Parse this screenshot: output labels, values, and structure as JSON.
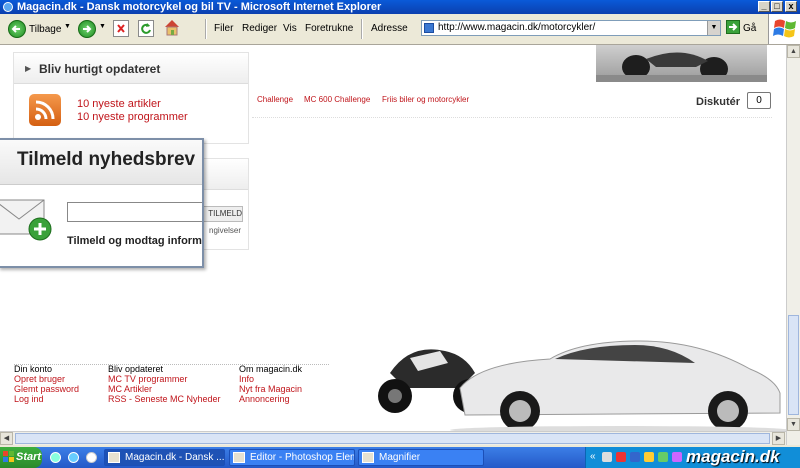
{
  "window": {
    "title": "Magacin.dk - Dansk motorcykel og bil TV - Microsoft Internet Explorer",
    "min": "_",
    "max": "□",
    "close": "x"
  },
  "toolbar": {
    "back_label": "Tilbage",
    "menu": [
      "Filer",
      "Rediger",
      "Vis",
      "Foretrukne"
    ],
    "address_label": "Adresse",
    "url": "http://www.magacin.dk/motorcykler/",
    "go_label": "Gå"
  },
  "page": {
    "bliv_title": "Bliv hurtigt opdateret",
    "bliv_links": [
      "10 nyeste artikler",
      "10 nyeste programmer"
    ],
    "tag_links": [
      "Challenge",
      "MC 600 Challenge",
      "Friis biler og motorcykler"
    ],
    "diskuter_label": "Diskutér",
    "diskuter_count": "0",
    "popup_title": "Tilmeld nyhedsbrev",
    "popup_button": "TILMELD",
    "popup_text": "Tilmeld og modtag informat",
    "behind_text": "ngivelser",
    "footer": [
      {
        "heading": "Din konto",
        "links": [
          "Opret bruger",
          "Glemt password",
          "Log ind"
        ]
      },
      {
        "heading": "Bliv opdateret",
        "links": [
          "MC TV programmer",
          "MC Artikler",
          "RSS - Seneste MC Nyheder"
        ]
      },
      {
        "heading": "Om magacin.dk",
        "links": [
          "Info",
          "Nyt fra Magacin",
          "Annoncering"
        ]
      }
    ]
  },
  "taskbar": {
    "start": "Start",
    "tasks": [
      "Magacin.dk - Dansk ...",
      "Editor - Photoshop Eleme...",
      "Magnifier"
    ],
    "watermark": "magacin.dk"
  },
  "colors": {
    "accent": "#c0151b",
    "titlebar": "#0b46bd",
    "taskbar": "#2c64d6"
  }
}
